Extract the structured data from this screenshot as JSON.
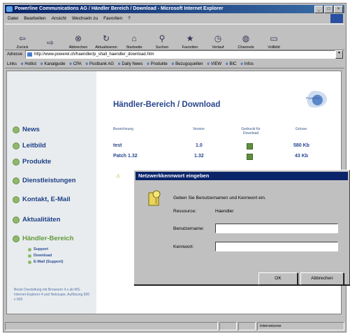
{
  "window": {
    "title": "Powerline Communications AG / Händler Bereich / Download - Microsoft Internet Explorer"
  },
  "menu": [
    "Datei",
    "Bearbeiten",
    "Ansicht",
    "Wechseln zu",
    "Favoriten",
    "?"
  ],
  "toolbar": [
    {
      "label": "Zurück",
      "icon": "back-icon"
    },
    {
      "label": "",
      "icon": "forward-icon"
    },
    {
      "label": "Abbrechen",
      "icon": "stop-icon"
    },
    {
      "label": "Aktualisieren",
      "icon": "refresh-icon"
    },
    {
      "label": "Startseite",
      "icon": "home-icon"
    },
    {
      "label": "Suchen",
      "icon": "search-icon"
    },
    {
      "label": "Favoriten",
      "icon": "favorites-icon"
    },
    {
      "label": "Verlauf",
      "icon": "history-icon"
    },
    {
      "label": "Channels",
      "icon": "channels-icon"
    },
    {
      "label": "Vollbild",
      "icon": "fullscreen-icon"
    }
  ],
  "address": {
    "label": "Adresse",
    "url": "http://www.powerel.ch/haendler/p_shall_haendler_download.htm"
  },
  "links": {
    "label": "Links",
    "items": [
      "Hotlist",
      "Kanalguide",
      "CPA",
      "Postbank AG",
      "Daily News",
      "Produkte",
      "Bezugsquellen",
      "VIEW",
      "BIC",
      "Infos"
    ]
  },
  "sidebar": {
    "items": [
      "News",
      "Leitbild",
      "Produkte",
      "Dienstleistungen",
      "Kontakt, E-Mail",
      "Aktualitäten",
      "Händler-Bereich"
    ],
    "sub": [
      "Support",
      "Download",
      "E-Mail (Support)"
    ],
    "footer": "Beste Darstellung mit Browsern 4.x ab MS-Internet-Explorer 4 und Netscape, Auflösung 800 x 600"
  },
  "main": {
    "title": "Händler-Bereich / Download",
    "logo_text": "Powerline",
    "headers": [
      "Bezeichnung",
      "Version",
      "Gedruckt für Download",
      "Grösse"
    ],
    "rows": [
      {
        "name": "test",
        "version": "1.0",
        "size": "580 Kb"
      },
      {
        "name": "Patch 1.32",
        "version": "1.32",
        "size": "43 Kb"
      }
    ]
  },
  "status": {
    "zone": "Internetzone"
  },
  "dialog": {
    "title": "Netzwerkkennwort eingeben",
    "prompt": "Geben Sie Benutzernamen und Kennwort ein.",
    "resource_label": "Ressource:",
    "resource_value": "Haendler",
    "user_label": "Benutzername:",
    "pass_label": "Kennwort:",
    "ok": "OK",
    "cancel": "Abbrechen"
  }
}
